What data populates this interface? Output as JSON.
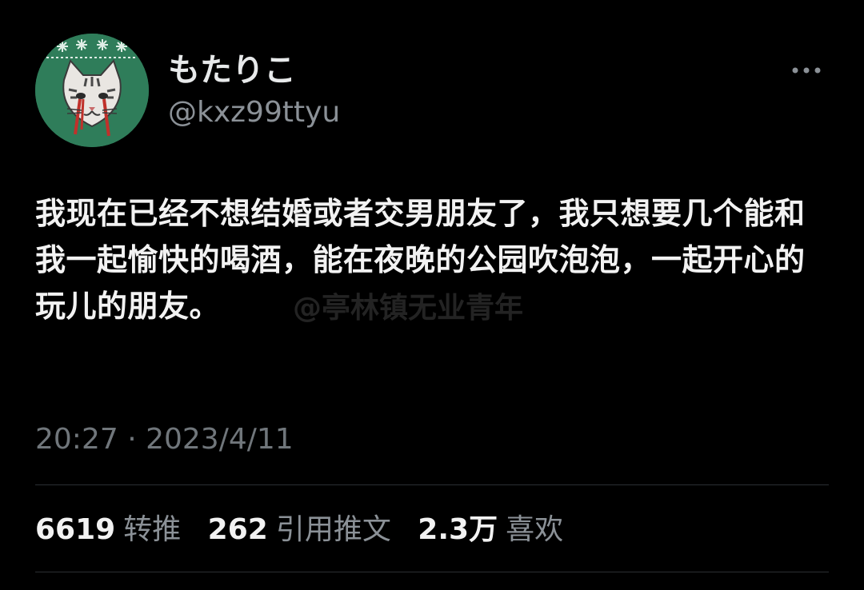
{
  "author": {
    "display_name": "もたりこ",
    "handle": "@kxz99ttyu"
  },
  "tweet": {
    "text": "我现在已经不想结婚或者交男朋友了，我只想要几个能和我一起愉快的喝酒，能在夜晚的公园吹泡泡，一起开心的玩儿的朋友。",
    "timestamp": "20:27 · 2023/4/11"
  },
  "watermark": "@亭林镇无业青年",
  "stats": {
    "retweets": {
      "count": "6619",
      "label": "转推"
    },
    "quotes": {
      "count": "262",
      "label": "引用推文"
    },
    "likes": {
      "count": "2.3万",
      "label": "喜欢"
    }
  },
  "icons": {
    "avatar": "cat-avatar",
    "more": "more-options-icon"
  },
  "colors": {
    "background": "#000000",
    "text_primary": "#e7e9ea",
    "text_secondary": "#8b9197",
    "avatar_bg": "#2f7d5a"
  }
}
